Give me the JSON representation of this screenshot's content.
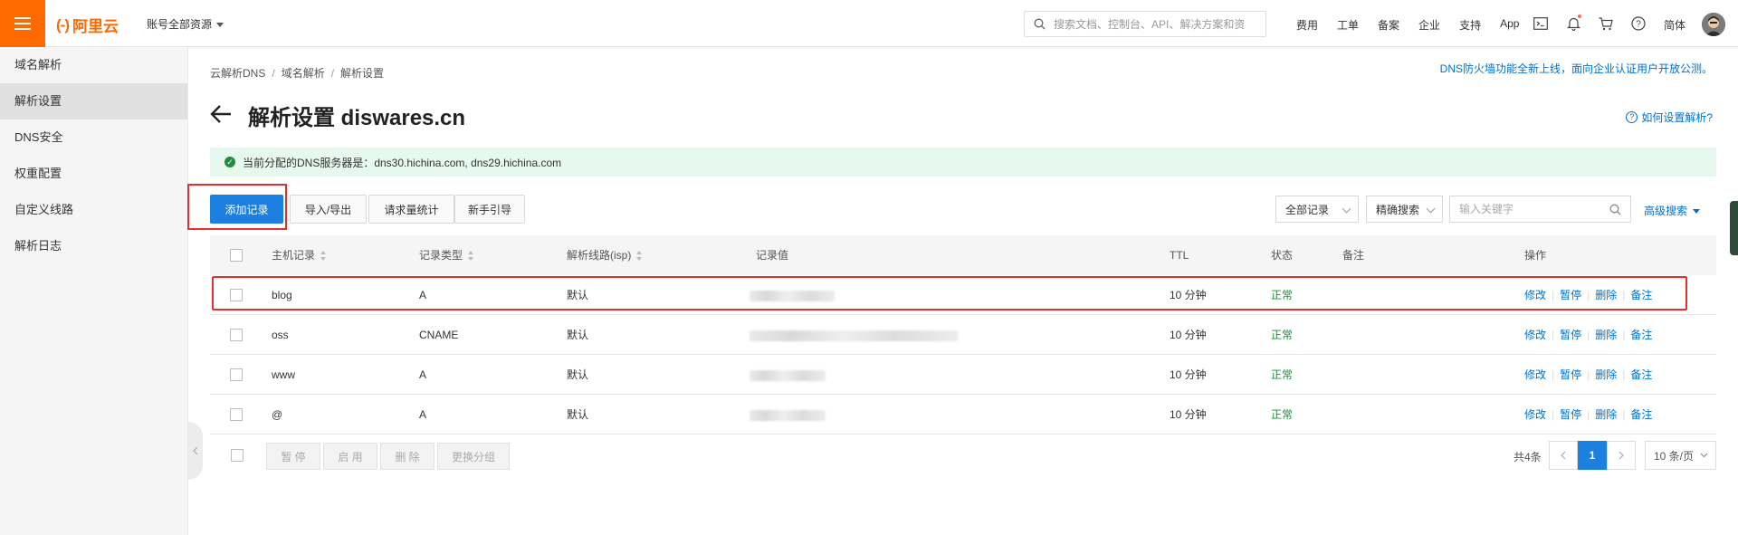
{
  "header": {
    "logo_text": "阿里云",
    "logo_mark": "(-)",
    "account": "账号全部资源",
    "search_placeholder": "搜索文档、控制台、API、解决方案和资",
    "nav": [
      "费用",
      "工单",
      "备案",
      "企业",
      "支持",
      "App"
    ],
    "lang": "简体",
    "brand_color": "#ff6a00"
  },
  "sidebar": {
    "items": [
      {
        "label": "域名解析",
        "active": false
      },
      {
        "label": "解析设置",
        "active": true
      },
      {
        "label": "DNS安全",
        "active": false
      },
      {
        "label": "权重配置",
        "active": false
      },
      {
        "label": "自定义线路",
        "active": false
      },
      {
        "label": "解析日志",
        "active": false
      }
    ]
  },
  "breadcrumb": [
    "云解析DNS",
    "域名解析",
    "解析设置"
  ],
  "announcement": "DNS防火墙功能全新上线，面向企业认证用户开放公测。",
  "page_title": "解析设置 diswares.cn",
  "help_link": "如何设置解析?",
  "notice": "当前分配的DNS服务器是：dns30.hichina.com, dns29.hichina.com",
  "toolbar": {
    "add": "添加记录",
    "import_export": "导入/导出",
    "stats": "请求量统计",
    "guide": "新手引导"
  },
  "filters": {
    "all_records": "全部记录",
    "exact_search": "精确搜索",
    "keyword_placeholder": "输入关键字",
    "advanced": "高级搜索"
  },
  "table": {
    "headers": {
      "host": "主机记录",
      "type": "记录类型",
      "line": "解析线路(isp)",
      "value": "记录值",
      "ttl": "TTL",
      "status": "状态",
      "remark": "备注",
      "actions": "操作"
    },
    "rows": [
      {
        "host": "blog",
        "type": "A",
        "line": "默认",
        "ttl": "10 分钟",
        "status": "正常"
      },
      {
        "host": "oss",
        "type": "CNAME",
        "line": "默认",
        "ttl": "10 分钟",
        "status": "正常"
      },
      {
        "host": "www",
        "type": "A",
        "line": "默认",
        "ttl": "10 分钟",
        "status": "正常"
      },
      {
        "host": "@",
        "type": "A",
        "line": "默认",
        "ttl": "10 分钟",
        "status": "正常"
      }
    ],
    "actions": {
      "edit": "修改",
      "pause": "暂停",
      "delete": "删除",
      "remark": "备注"
    }
  },
  "bulk": {
    "pause": "暂 停",
    "enable": "启 用",
    "delete": "删 除",
    "group": "更换分组"
  },
  "pagination": {
    "total": "共4条",
    "current": "1",
    "page_size": "10 条/页"
  }
}
